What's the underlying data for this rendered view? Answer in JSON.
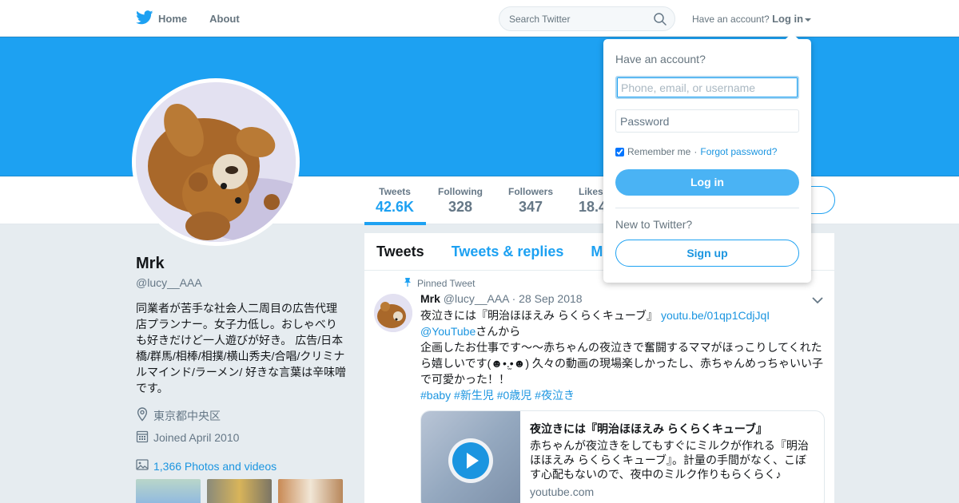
{
  "nav": {
    "home_label": "Home",
    "about_label": "About",
    "search_placeholder": "Search Twitter",
    "account_prompt": "Have an account?",
    "login_label": "Log in"
  },
  "profile": {
    "name": "Mrk",
    "handle": "@lucy__AAA",
    "bio": "同業者が苦手な社会人二周目の広告代理店プランナー。女子力低し。おしゃべりも好きだけど一人遊びが好き。 広告/日本橋/群馬/相棒/相撲/横山秀夫/合唱/クリミナルマインド/ラーメン/ 好きな言葉は辛味噌です。",
    "location": "東京都中央区",
    "joined": "Joined April 2010",
    "photos_link": "1,366 Photos and videos"
  },
  "stats": [
    {
      "label": "Tweets",
      "value": "42.6K"
    },
    {
      "label": "Following",
      "value": "328"
    },
    {
      "label": "Followers",
      "value": "347"
    },
    {
      "label": "Likes",
      "value": "18.4"
    }
  ],
  "timeline": {
    "tabs": [
      "Tweets",
      "Tweets & replies",
      "M"
    ],
    "pinned_label": "Pinned Tweet",
    "tweet": {
      "author": "Mrk",
      "handle": "@lucy__AAA",
      "date": "· 28 Sep 2018",
      "line1_text": "夜泣きには『明治ほほえみ らくらくキューブ』 ",
      "line1_link": "youtu.be/01qp1CdjJqI",
      "mention": "@YouTube",
      "mention_suffix": "さんから",
      "body": "企画したお仕事です～～赤ちゃんの夜泣きで奮闘するママがほっこりしてくれたら嬉しいです(☻•.̫•☻) 久々の動画の現場楽しかったし、赤ちゃんめっちゃいい子で可愛かった！！",
      "hashtags": "#baby #新生児 #0歳児 #夜泣き"
    },
    "card": {
      "title": "夜泣きには『明治ほほえみ らくらくキューブ』",
      "description": "赤ちゃんが夜泣きをしてもすぐにミルクが作れる『明治ほほえみ らくらくキューブ』。計量の手間がなく、こぼす心配もないので、夜中のミルク作りもらくらく♪",
      "domain": "youtube.com"
    }
  },
  "login_dropdown": {
    "title": "Have an account?",
    "username_placeholder": "Phone, email, or username",
    "password_placeholder": "Password",
    "remember_label": "Remember me",
    "separator": "·",
    "forgot_label": "Forgot password?",
    "login_button": "Log in",
    "new_prompt": "New to Twitter?",
    "signup_button": "Sign up"
  },
  "colors": {
    "brand": "#1da1f2",
    "link": "#1b95e0",
    "muted": "#657786"
  }
}
